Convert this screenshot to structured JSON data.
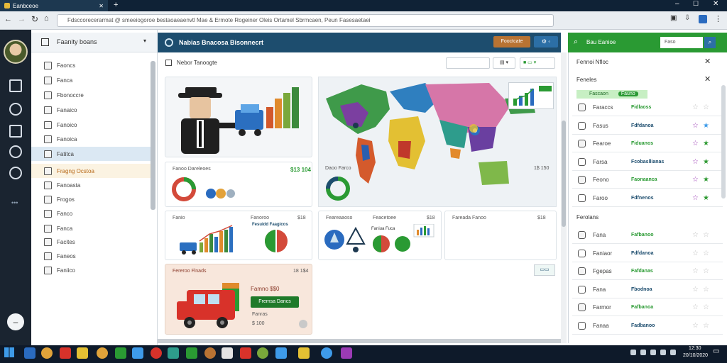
{
  "window": {
    "tab_title": "Eanbceoe"
  },
  "address": {
    "url": "Fdsccorecerarmat @ smeeiogoroe bestaoaeaenvtl Mae & Ermote Rogeiner Oleis Ortamel Sbrmcaen, Peun Fasesaetaei"
  },
  "sidebar": {
    "title": "Faanity boans",
    "items": [
      {
        "label": "Faoncs"
      },
      {
        "label": "Fanca"
      },
      {
        "label": "Fbonoccre"
      },
      {
        "label": "Fanaico"
      },
      {
        "label": "Fanoico"
      },
      {
        "label": "Fanoica"
      },
      {
        "label": "Fatitca"
      },
      {
        "label": "Fragng Ocstoa"
      },
      {
        "label": "Fanoasta"
      },
      {
        "label": "Frogos"
      },
      {
        "label": "Fanco"
      },
      {
        "label": "Fanca"
      },
      {
        "label": "Facites"
      },
      {
        "label": "Faneos"
      },
      {
        "label": "Faniico"
      }
    ]
  },
  "main": {
    "title": "Nabias Bnacosa Bisonnecrt",
    "btn_primary": "Fooctcate",
    "section_title": "Nebor Tanoogte",
    "select_value": "",
    "card_stats": {
      "label": "Fanoo Dareleoes",
      "value": "$13 104"
    },
    "card_map_footer": {
      "label": "Daoo Farco",
      "value": "1$ 150"
    },
    "card_bars": {
      "label": "Fanio",
      "label2": "Fanoroo",
      "value": "$18",
      "caption": "Fesuidd Faagicos"
    },
    "card_alerts": {
      "label": "Feareaaoso",
      "label2": "Feacetoee",
      "value": "$18",
      "caption": "Faniua Fuca"
    },
    "card_empty": {
      "label": "Fareada Fanoo",
      "value": "$18"
    },
    "card_truck": {
      "label": "Fereroo Flnads",
      "value": "18 1$4",
      "price": "Famno $$0",
      "button": "Fremsa Dancs",
      "caption": "Fanras",
      "sub": "$ 100"
    }
  },
  "right": {
    "search_value": "Faso",
    "title": "Bau Eanioe",
    "sec1": "Fennoi Nfloc",
    "sec2": "Feneles",
    "badge": "Fascaon",
    "badge2": "Fauno",
    "rows1": [
      {
        "a": "Faraccs",
        "b": "Fidlaoss"
      },
      {
        "a": "Fasus",
        "b": "Fdfdanoa"
      },
      {
        "a": "Fearoe",
        "b": "Fiduanos"
      },
      {
        "a": "Farsa",
        "b": "Fcobasllianas"
      },
      {
        "a": "Feono",
        "b": "Faonaanca"
      },
      {
        "a": "Faroo",
        "b": "Fdfnenos"
      }
    ],
    "sec3": "Ferolans",
    "rows2": [
      {
        "a": "Fana",
        "b": "Fafbanoo"
      },
      {
        "a": "Faniaor",
        "b": "Fdfdanoa"
      },
      {
        "a": "Fgepas",
        "b": "Fafdanas"
      },
      {
        "a": "Fana",
        "b": "Fbodnoa"
      },
      {
        "a": "Farmor",
        "b": "Fafbanoa"
      },
      {
        "a": "Fanaa",
        "b": "Fadbanoo"
      }
    ]
  },
  "taskbar": {
    "time": "12:30",
    "date": "20/10/2020"
  },
  "colors": {
    "accent_blue": "#1d4d6e",
    "accent_green": "#2a9a33",
    "star_purple": "#9b3bb5",
    "star_green": "#2f9a33",
    "dark": "#0f2236"
  }
}
